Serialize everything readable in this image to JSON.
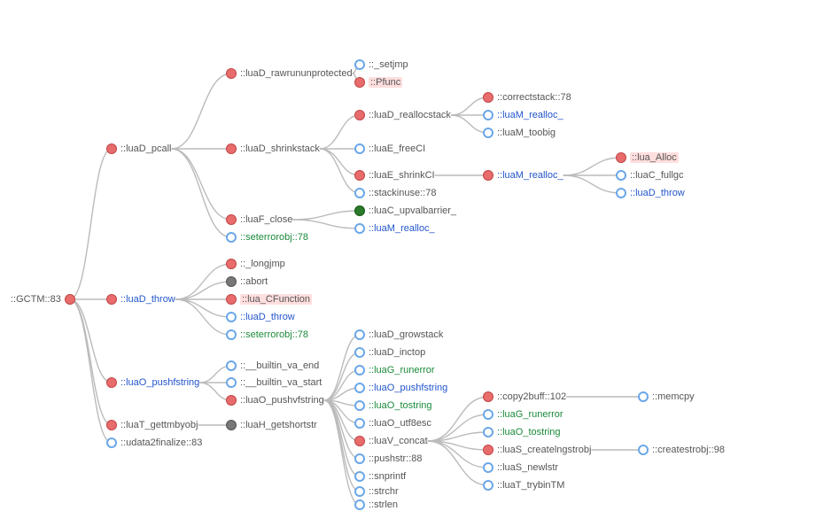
{
  "root": {
    "label": "::GCTM::83"
  },
  "c1": {
    "luaD_pcall": {
      "label": "::luaD_pcall"
    },
    "luaD_throw": {
      "label": "::luaD_throw"
    },
    "luaO_pushfstring": {
      "label": "::luaO_pushfstring"
    },
    "luaT_gettmbyobj": {
      "label": "::luaT_gettmbyobj"
    },
    "udata2finalize": {
      "label": "::udata2finalize::83"
    }
  },
  "c2": {
    "luaD_rawrununprotected": {
      "label": "::luaD_rawrununprotected"
    },
    "luaD_shrinkstack": {
      "label": "::luaD_shrinkstack"
    },
    "luaF_close": {
      "label": "::luaF_close"
    },
    "seterrorobj1": {
      "label": "::seterrorobj::78"
    },
    "longjmp": {
      "label": "::_longjmp"
    },
    "abort": {
      "label": "::abort"
    },
    "lua_CFunction": {
      "label": "::lua_CFunction"
    },
    "luaD_throw_r": {
      "label": "::luaD_throw"
    },
    "seterrorobj2": {
      "label": "::seterrorobj::78"
    },
    "builtin_va_end": {
      "label": "::__builtin_va_end"
    },
    "builtin_va_start": {
      "label": "::__builtin_va_start"
    },
    "luaO_pushvfstring": {
      "label": "::luaO_pushvfstring"
    },
    "luaH_getshortstr": {
      "label": "::luaH_getshortstr"
    }
  },
  "c3": {
    "setjmp": {
      "label": "::_setjmp"
    },
    "Pfunc": {
      "label": "::Pfunc"
    },
    "luaD_reallocstack": {
      "label": "::luaD_reallocstack"
    },
    "luaE_freeCI": {
      "label": "::luaE_freeCI"
    },
    "luaE_shrinkCI": {
      "label": "::luaE_shrinkCI"
    },
    "stackinuse": {
      "label": "::stackinuse::78"
    },
    "luaC_upvalbarrier": {
      "label": "::luaC_upvalbarrier_"
    },
    "luaM_realloc_a": {
      "label": "::luaM_realloc_"
    },
    "luaD_growstack": {
      "label": "::luaD_growstack"
    },
    "luaD_inctop": {
      "label": "::luaD_inctop"
    },
    "luaG_runerror_a": {
      "label": "::luaG_runerror"
    },
    "luaO_pushfstring_r": {
      "label": "::luaO_pushfstring"
    },
    "luaO_tostring_a": {
      "label": "::luaO_tostring"
    },
    "luaO_utf8esc": {
      "label": "::luaO_utf8esc"
    },
    "luaV_concat": {
      "label": "::luaV_concat"
    },
    "pushstr": {
      "label": "::pushstr::88"
    },
    "snprintf": {
      "label": "::snprintf"
    },
    "strchr": {
      "label": "::strchr"
    },
    "strlen": {
      "label": "::strlen"
    }
  },
  "c4": {
    "correctstack": {
      "label": "::correctstack::78"
    },
    "luaM_realloc_b": {
      "label": "::luaM_realloc_"
    },
    "luaM_toobig": {
      "label": "::luaM_toobig"
    },
    "luaM_realloc_c": {
      "label": "::luaM_realloc_"
    },
    "copy2buff": {
      "label": "::copy2buff::102"
    },
    "luaG_runerror_b": {
      "label": "::luaG_runerror"
    },
    "luaO_tostring_b": {
      "label": "::luaO_tostring"
    },
    "luaS_createlngstrobj": {
      "label": "::luaS_createlngstrobj"
    },
    "luaS_newlstr": {
      "label": "::luaS_newlstr"
    },
    "luaT_trybinTM": {
      "label": "::luaT_trybinTM"
    }
  },
  "c5": {
    "lua_Alloc": {
      "label": "::lua_Alloc"
    },
    "luaC_fullgc": {
      "label": "::luaC_fullgc"
    },
    "luaD_throw_e": {
      "label": "::luaD_throw"
    },
    "memcpy": {
      "label": "::memcpy"
    },
    "createstrobj": {
      "label": "::createstrobj::98"
    }
  }
}
